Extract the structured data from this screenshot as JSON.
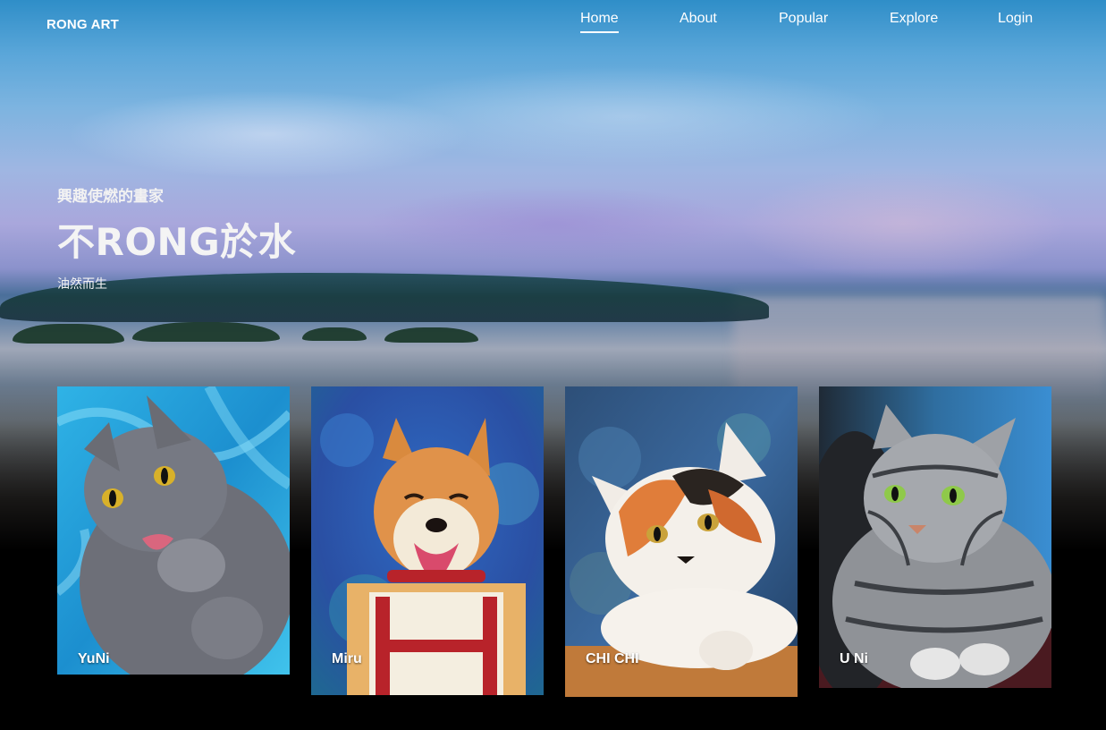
{
  "brand": "RONG ART",
  "nav": {
    "items": [
      {
        "label": "Home",
        "active": true
      },
      {
        "label": "About",
        "active": false
      },
      {
        "label": "Popular",
        "active": false
      },
      {
        "label": "Explore",
        "active": false
      },
      {
        "label": "Login",
        "active": false
      }
    ]
  },
  "hero": {
    "kicker": "興趣使燃的畫家",
    "title": "不RONG於水",
    "subtitle": "油然而生"
  },
  "gallery": {
    "cards": [
      {
        "name": "YuNi",
        "subject": "gray-cat-painting"
      },
      {
        "name": "Miru",
        "subject": "shiba-dog-painting"
      },
      {
        "name": "CHI CHI",
        "subject": "calico-cat-painting"
      },
      {
        "name": "U Ni",
        "subject": "tabby-cat-painting"
      }
    ]
  },
  "colors": {
    "sky": "#5aa6d9",
    "background": "#000000",
    "text": "#ffffff"
  }
}
